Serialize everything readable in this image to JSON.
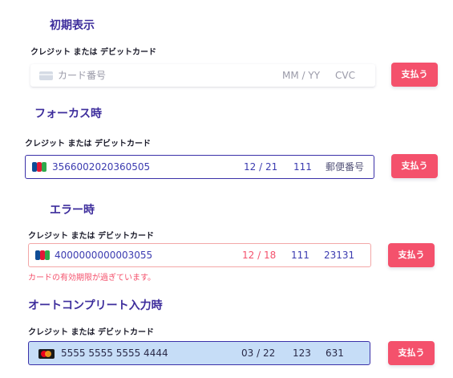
{
  "sections": [
    {
      "title": "初期表示",
      "label": "クレジット または デビットカード",
      "icon": "generic-card-icon",
      "number": "カード番号",
      "expiry": "MM / YY",
      "cvc": "CVC",
      "postal": "",
      "button": "支払う",
      "error": ""
    },
    {
      "title": "フォーカス時",
      "label": "クレジット または デビットカード",
      "icon": "jcb-icon",
      "number": "3566002020360505",
      "expiry": "12 / 21",
      "cvc": "111",
      "postal": "郵便番号",
      "button": "支払う",
      "error": ""
    },
    {
      "title": "エラー時",
      "label": "クレジット または デビットカード",
      "icon": "jcb-icon",
      "number": "4000000000003055",
      "expiry": "12 / 18",
      "cvc": "111",
      "postal": "23131",
      "button": "支払う",
      "error": "カードの有効期限が過ぎています。"
    },
    {
      "title": "オートコンプリート入力時",
      "label": "クレジット または デビットカード",
      "icon": "mastercard-icon",
      "number": "5555 5555 5555 4444",
      "expiry": "03 / 22",
      "cvc": "123",
      "postal": "631",
      "button": "支払う",
      "error": ""
    }
  ],
  "colors": {
    "title": "#3d2d9c",
    "focus_border": "#3b31a8",
    "error_border": "#f3a7a7",
    "error_text": "#f4516c",
    "button": "#f4516c",
    "autofill_bg": "#c6ddf7"
  }
}
